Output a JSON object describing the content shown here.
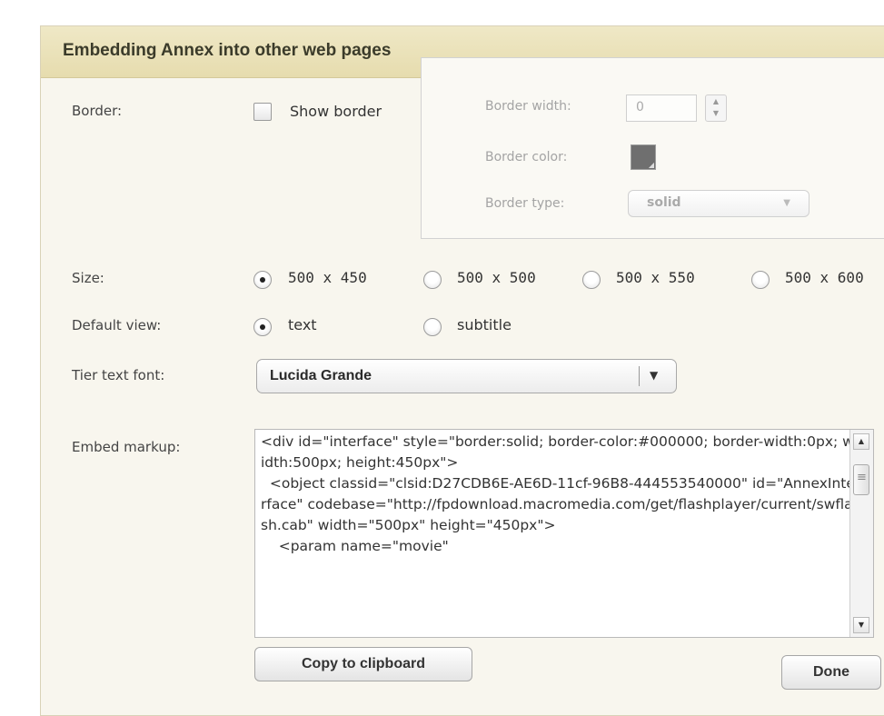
{
  "dialog": {
    "title": "Embedding Annex into other web pages"
  },
  "border": {
    "label": "Border:",
    "show_border_label": "Show border",
    "show_border_checked": false,
    "width_label": "Border width:",
    "width_value": "0",
    "color_label": "Border color:",
    "color_value": "#6f6f6f",
    "type_label": "Border type:",
    "type_value": "solid"
  },
  "size": {
    "label": "Size:",
    "options": [
      "500 x 450",
      "500 x 500",
      "500 x 550",
      "500 x 600"
    ],
    "selected": "500 x 450"
  },
  "default_view": {
    "label": "Default view:",
    "options": [
      "text",
      "subtitle"
    ],
    "selected": "text"
  },
  "tier_font": {
    "label": "Tier text font:",
    "value": "Lucida Grande"
  },
  "embed": {
    "label": "Embed markup:",
    "markup": "<div id=\"interface\" style=\"border:solid; border-color:#000000; border-width:0px; width:500px; height:450px\">\n  <object classid=\"clsid:D27CDB6E-AE6D-11cf-96B8-444553540000\" id=\"AnnexInterface\" codebase=\"http://fpdownload.macromedia.com/get/flashplayer/current/swflash.cab\" width=\"500px\" height=\"450px\">\n    <param name=\"movie\""
  },
  "buttons": {
    "copy": "Copy to clipboard",
    "done": "Done"
  }
}
